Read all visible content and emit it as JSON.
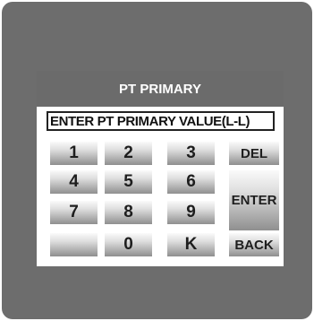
{
  "screen": {
    "title": "PT PRIMARY",
    "entry_text": "ENTER PT PRIMARY VALUE(L-L)"
  },
  "keypad": {
    "k1": "1",
    "k2": "2",
    "k3": "3",
    "k4": "4",
    "k5": "5",
    "k6": "6",
    "k7": "7",
    "k8": "8",
    "k9": "9",
    "blank": "",
    "k0": "0",
    "kK": "K",
    "del": "DEL",
    "enter": "ENTER",
    "back": "BACK"
  }
}
